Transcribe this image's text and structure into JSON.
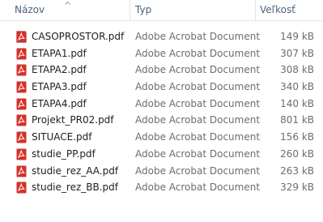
{
  "columns": {
    "name": "Názov",
    "type": "Typ",
    "size": "Veľkosť"
  },
  "sort_icon": "sort-ascending-icon",
  "file_icon": "pdf-file-icon",
  "accent_pdf_red": "#d6302a",
  "files": [
    {
      "name": "CASOPROSTOR.pdf",
      "type": "Adobe Acrobat Document",
      "size": "149 kB"
    },
    {
      "name": "ETAPA1.pdf",
      "type": "Adobe Acrobat Document",
      "size": "307 kB"
    },
    {
      "name": "ETAPA2.pdf",
      "type": "Adobe Acrobat Document",
      "size": "308 kB"
    },
    {
      "name": "ETAPA3.pdf",
      "type": "Adobe Acrobat Document",
      "size": "340 kB"
    },
    {
      "name": "ETAPA4.pdf",
      "type": "Adobe Acrobat Document",
      "size": "140 kB"
    },
    {
      "name": "Projekt_PR02.pdf",
      "type": "Adobe Acrobat Document",
      "size": "801 kB"
    },
    {
      "name": "SITUACE.pdf",
      "type": "Adobe Acrobat Document",
      "size": "156 kB"
    },
    {
      "name": "studie_PP.pdf",
      "type": "Adobe Acrobat Document",
      "size": "260 kB"
    },
    {
      "name": "studie_rez_AA.pdf",
      "type": "Adobe Acrobat Document",
      "size": "263 kB"
    },
    {
      "name": "studie_rez_BB.pdf",
      "type": "Adobe Acrobat Document",
      "size": "329 kB"
    }
  ]
}
